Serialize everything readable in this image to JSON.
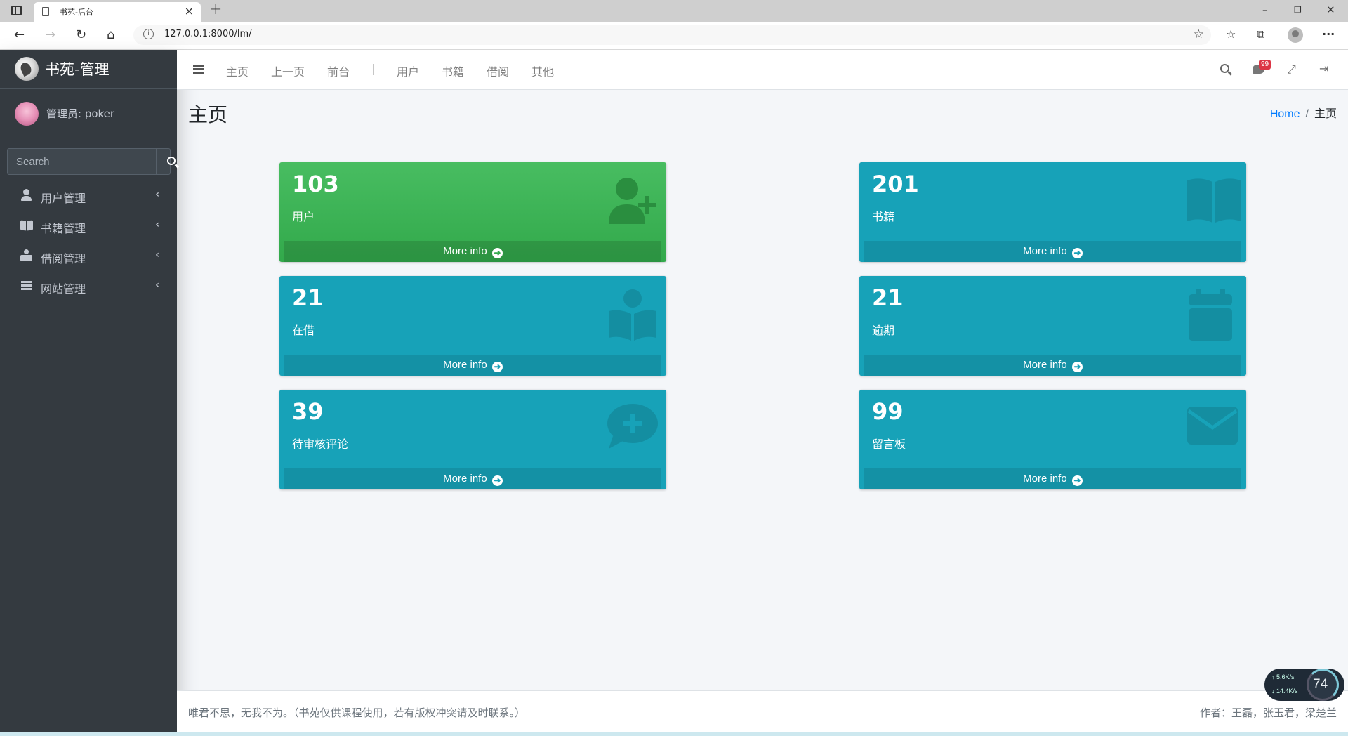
{
  "browser": {
    "tab_title": "书苑-后台",
    "url": "127.0.0.1:8000/lm/"
  },
  "sidebar": {
    "brand": "书苑-管理",
    "user": "管理员: poker",
    "search_placeholder": "Search",
    "items": [
      {
        "label": "用户管理",
        "icon": "user-icon"
      },
      {
        "label": "书籍管理",
        "icon": "book-open-icon"
      },
      {
        "label": "借阅管理",
        "icon": "book-reader-icon"
      },
      {
        "label": "网站管理",
        "icon": "bars-icon"
      }
    ]
  },
  "topnav": {
    "links": [
      "主页",
      "上一页",
      "前台",
      "用户",
      "书籍",
      "借阅",
      "其他"
    ],
    "separator": "|",
    "notification_count": "99"
  },
  "content": {
    "title": "主页",
    "breadcrumb_home": "Home",
    "breadcrumb_current": "主页"
  },
  "boxes": [
    {
      "number": "103",
      "label": "用户",
      "footer": "More info",
      "color": "#3fb456",
      "icon": "user-plus-icon"
    },
    {
      "number": "201",
      "label": "书籍",
      "footer": "More info",
      "color": "#17a2b8",
      "icon": "book-open-icon"
    },
    {
      "number": "21",
      "label": "在借",
      "footer": "More info",
      "color": "#17a2b8",
      "icon": "book-reader-icon"
    },
    {
      "number": "21",
      "label": "逾期",
      "footer": "More info",
      "color": "#17a2b8",
      "icon": "calendar-icon"
    },
    {
      "number": "39",
      "label": "待审核评论",
      "footer": "More info",
      "color": "#17a2b8",
      "icon": "comment-medical-icon"
    },
    {
      "number": "99",
      "label": "留言板",
      "footer": "More info",
      "color": "#17a2b8",
      "icon": "envelope-icon"
    }
  ],
  "footer": {
    "left": "唯君不思，无我不为。（书苑仅供课程使用，若有版权冲突请及时联系。）",
    "right": "作者：王磊，张玉君，梁楚兰"
  },
  "net_widget": {
    "up": "5.6K/s",
    "down": "14.4K/s",
    "percent": "74"
  }
}
